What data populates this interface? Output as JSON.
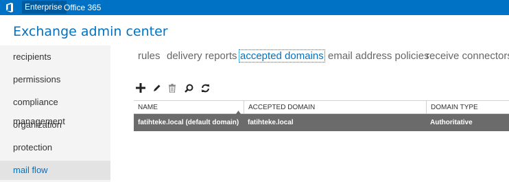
{
  "topbar": {
    "nav": [
      "Enterprise",
      "Office 365"
    ]
  },
  "app": {
    "title": "Exchange admin center"
  },
  "sidebar": {
    "items": [
      {
        "label": "recipients"
      },
      {
        "label": "permissions"
      },
      {
        "label": "compliance management"
      },
      {
        "label": "organization"
      },
      {
        "label": "protection"
      },
      {
        "label": "mail flow",
        "selected": true
      }
    ]
  },
  "tabs": [
    {
      "label": "rules"
    },
    {
      "label": "delivery reports"
    },
    {
      "label": "accepted domains",
      "active": true
    },
    {
      "label": "email address policies"
    },
    {
      "label": "receive connectors"
    }
  ],
  "toolbar": {
    "buttons": [
      "add-icon",
      "edit-icon",
      "delete-icon",
      "search-icon",
      "refresh-icon"
    ]
  },
  "grid": {
    "columns": [
      "NAME",
      "ACCEPTED DOMAIN",
      "DOMAIN TYPE"
    ],
    "sorted_column": "NAME",
    "rows": [
      {
        "name": "fatihteke.local (default domain)",
        "domain": "fatihteke.local",
        "type": "Authoritative",
        "selected": true
      }
    ]
  },
  "colors": {
    "accent": "#0072c6",
    "nav_bg": "#f4f4f4",
    "selected_row": "#6b6b6b"
  }
}
